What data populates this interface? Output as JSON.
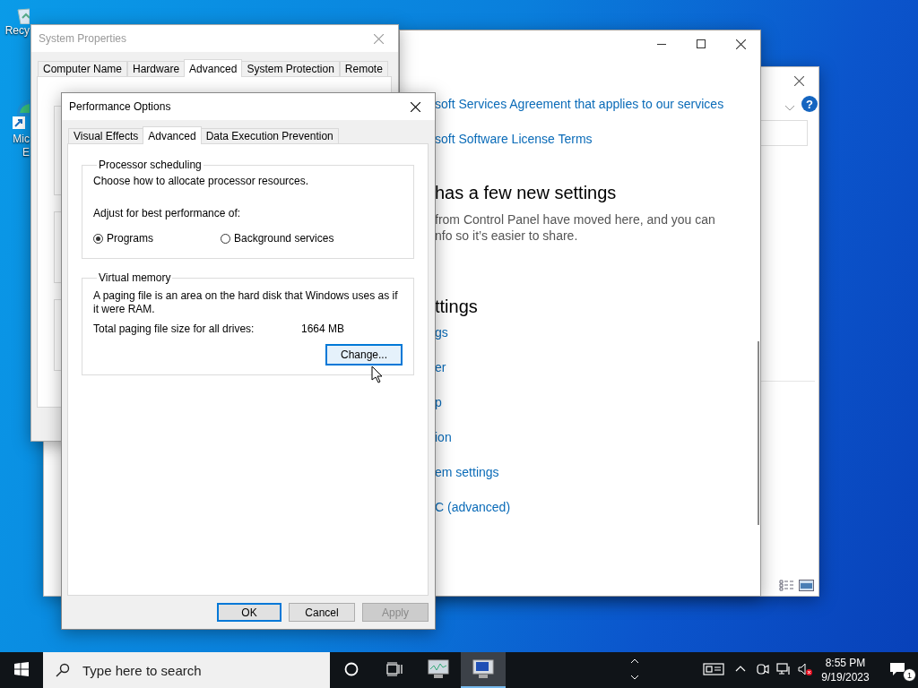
{
  "desktop_icons": [
    {
      "kind": "recycle-bin",
      "lines": [
        "Recy"
      ]
    },
    {
      "kind": "edge",
      "lines": [
        "Mic",
        "E"
      ]
    }
  ],
  "control_panel": {
    "help": "?"
  },
  "settings_window": {
    "items": [
      {
        "kind": "link",
        "text": "soft Services Agreement that applies to our services"
      },
      {
        "kind": "link",
        "text": "soft Software License Terms"
      },
      {
        "kind": "heading",
        "text": "has a few new settings"
      },
      {
        "kind": "text",
        "lines": [
          "from Control Panel have moved here, and you can",
          "nfo so it’s easier to share."
        ]
      },
      {
        "kind": "heading",
        "text": "ttings"
      },
      {
        "kind": "link",
        "text": "gs"
      },
      {
        "kind": "link",
        "text": "er"
      },
      {
        "kind": "link",
        "text": "p"
      },
      {
        "kind": "link",
        "text": "ion"
      },
      {
        "kind": "link",
        "text": "em settings"
      },
      {
        "kind": "link",
        "text": "C (advanced)"
      }
    ]
  },
  "system_properties": {
    "title": "System Properties",
    "tabs": [
      {
        "label": "Computer Name",
        "selected": false
      },
      {
        "label": "Hardware",
        "selected": false
      },
      {
        "label": "Advanced",
        "selected": true
      },
      {
        "label": "System Protection",
        "selected": false
      },
      {
        "label": "Remote",
        "selected": false
      }
    ]
  },
  "performance_options": {
    "title": "Performance Options",
    "tabs": [
      {
        "label": "Visual Effects",
        "selected": false
      },
      {
        "label": "Advanced",
        "selected": true
      },
      {
        "label": "Data Execution Prevention",
        "selected": false
      }
    ],
    "processor_scheduling": {
      "legend": "Processor scheduling",
      "description": "Choose how to allocate processor resources.",
      "prompt": "Adjust for best performance of:",
      "options": [
        {
          "label": "Programs",
          "selected": true
        },
        {
          "label": "Background services",
          "selected": false
        }
      ]
    },
    "virtual_memory": {
      "legend": "Virtual memory",
      "description": "A paging file is an area on the hard disk that Windows uses as if it were RAM.",
      "total_label": "Total paging file size for all drives:",
      "total_value": "1664 MB",
      "change_button": "Change..."
    },
    "buttons": [
      {
        "label": "OK",
        "kind": "default",
        "disabled": false
      },
      {
        "label": "Cancel",
        "kind": "normal",
        "disabled": false
      },
      {
        "label": "Apply",
        "kind": "normal",
        "disabled": true
      }
    ]
  },
  "taskbar": {
    "search_placeholder": "Type here to search",
    "apps": [
      {
        "kind": "monitor-chart",
        "selected": false
      },
      {
        "kind": "monitor-blue",
        "selected": true
      }
    ],
    "volume_muted": true,
    "time": "8:55 PM",
    "date": "9/19/2023",
    "notification_count": "1"
  }
}
